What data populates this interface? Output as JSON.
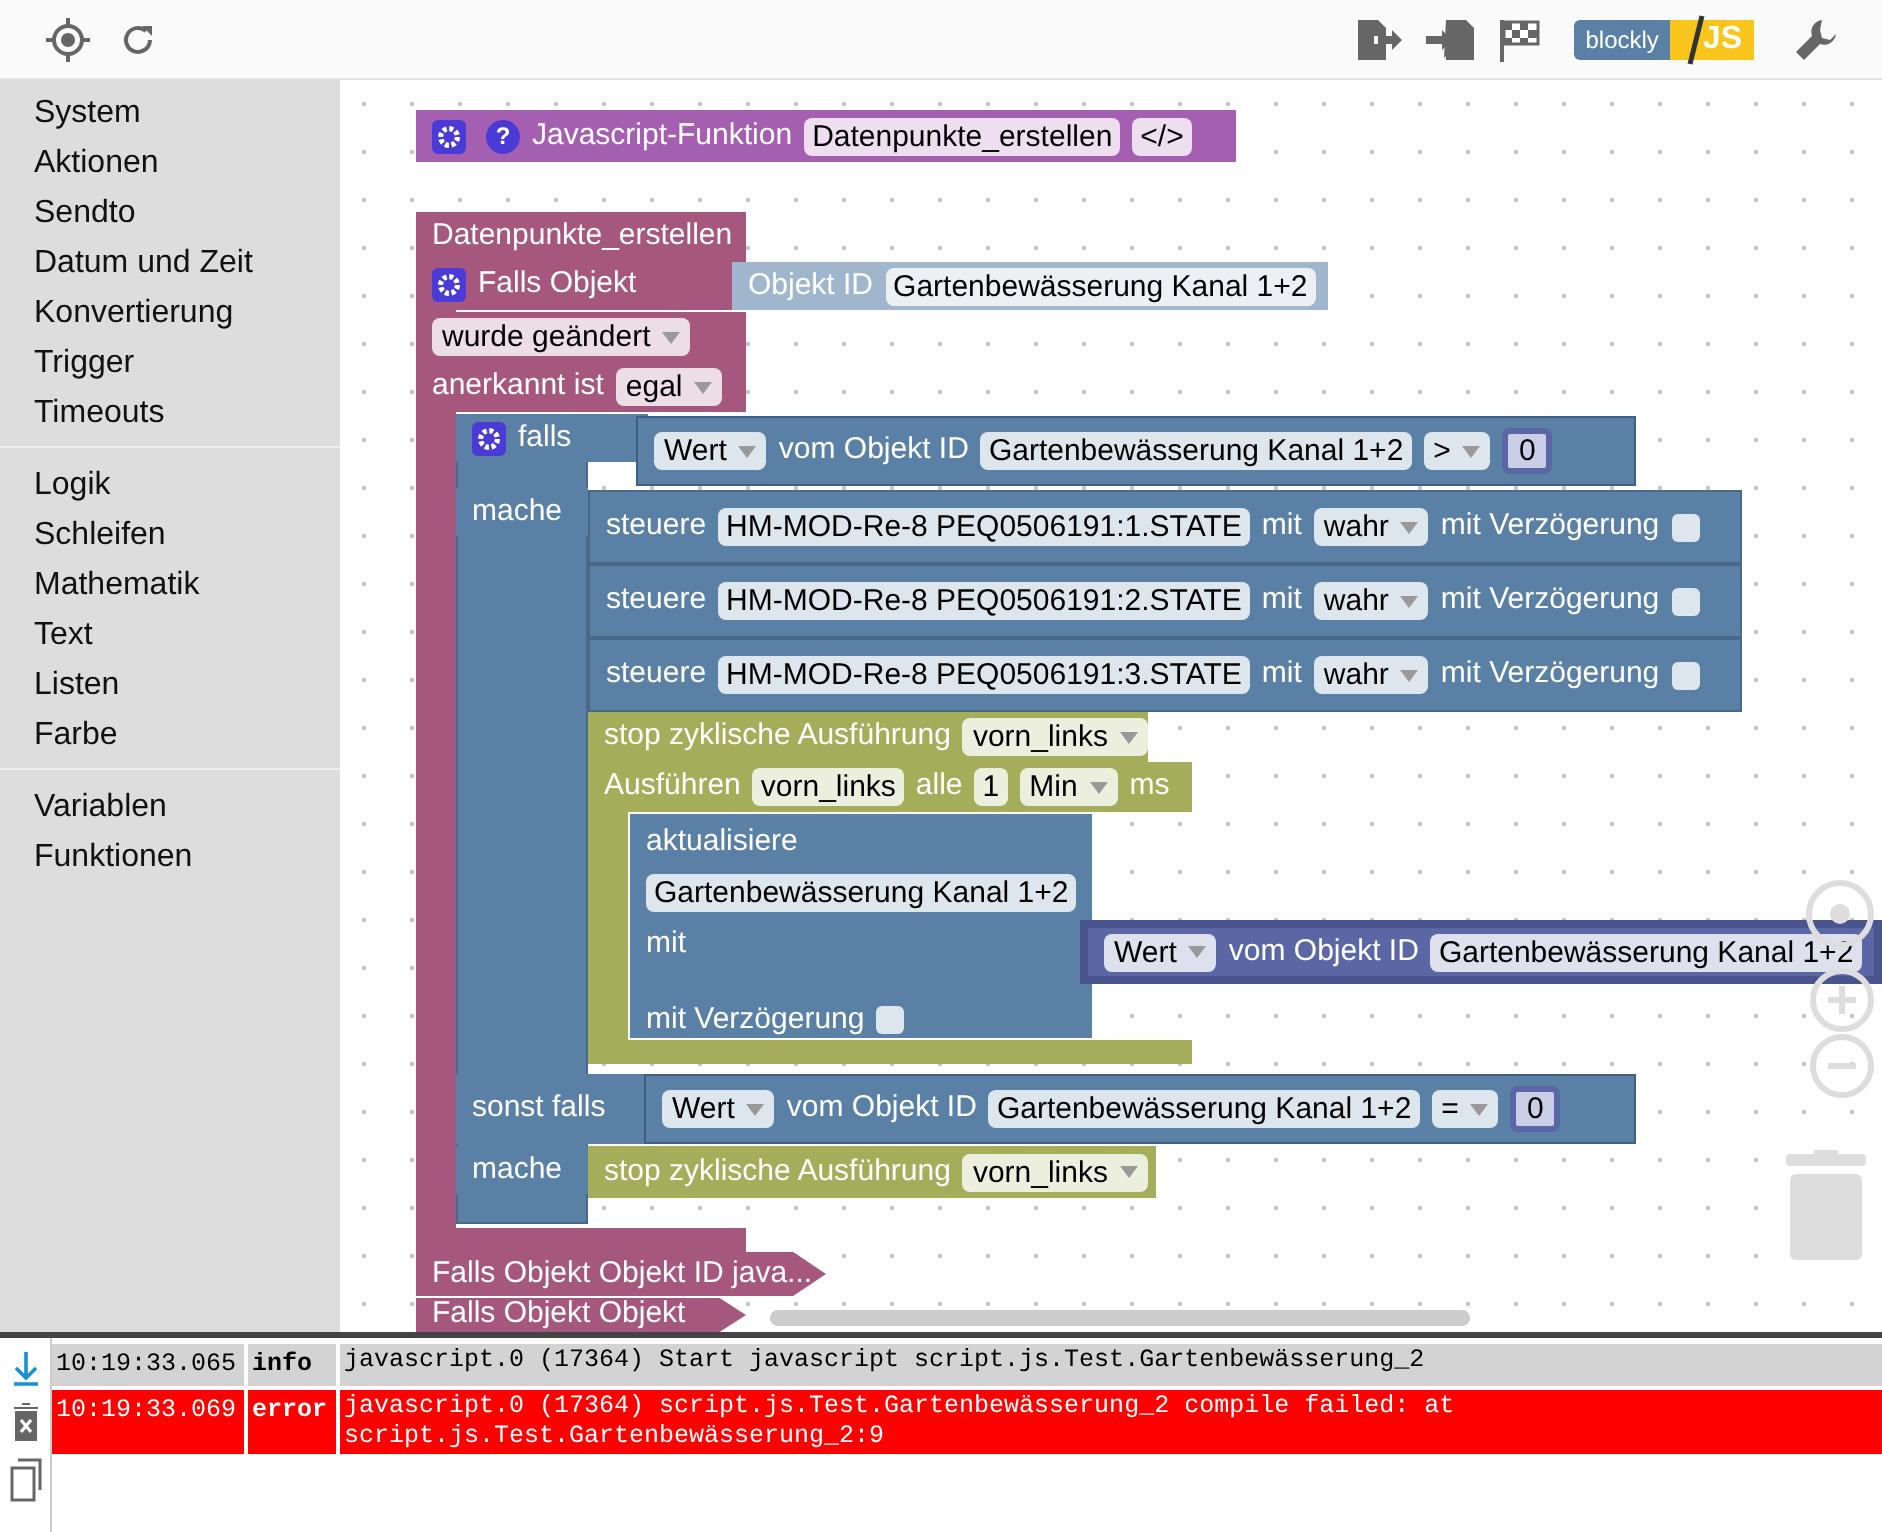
{
  "toolbar": {
    "mode_toggle": {
      "left": "blockly",
      "right": "JS"
    }
  },
  "sidebar": {
    "groups": [
      [
        "System",
        "Aktionen",
        "Sendto",
        "Datum und Zeit",
        "Konvertierung",
        "Trigger",
        "Timeouts"
      ],
      [
        "Logik",
        "Schleifen",
        "Mathematik",
        "Text",
        "Listen",
        "Farbe"
      ],
      [
        "Variablen",
        "Funktionen"
      ]
    ]
  },
  "blocks": [
    {
      "kind": "function",
      "parts": [
        {
          "kind": "gear"
        },
        {
          "kind": "help",
          "text": "?"
        },
        {
          "kind": "label",
          "text": "Javascript-Funktion"
        },
        {
          "kind": "field",
          "text": "Datenpunkte_erstellen"
        },
        {
          "kind": "field",
          "text": "</>"
        }
      ]
    },
    {
      "kind": "trigger",
      "parts": [
        {
          "kind": "label",
          "text": "Datenpunkte_erstellen"
        }
      ]
    },
    {
      "kind": "trigger",
      "parts": [
        {
          "kind": "gear"
        },
        {
          "kind": "label",
          "text": "Falls Objekt"
        }
      ]
    },
    {
      "kind": "objectid",
      "parts": [
        {
          "kind": "label",
          "text": "Objekt ID"
        },
        {
          "kind": "field",
          "text": "Gartenbewässerung Kanal 1+2"
        }
      ]
    },
    {
      "kind": "trigger",
      "parts": [
        {
          "kind": "dropdown",
          "text": "wurde geändert"
        }
      ]
    },
    {
      "kind": "trigger",
      "parts": [
        {
          "kind": "label",
          "text": "anerkannt ist"
        },
        {
          "kind": "dropdown",
          "text": "egal"
        }
      ]
    },
    {
      "kind": "logic",
      "parts": [
        {
          "kind": "gear"
        },
        {
          "kind": "label",
          "text": "falls"
        }
      ]
    },
    {
      "kind": "value",
      "parts": [
        {
          "kind": "dropdown",
          "text": "Wert"
        },
        {
          "kind": "label",
          "text": "vom Objekt ID"
        },
        {
          "kind": "field",
          "text": "Gartenbewässerung Kanal 1+2"
        },
        {
          "kind": "dropdown",
          "text": ">"
        },
        {
          "kind": "number",
          "text": "0"
        }
      ]
    },
    {
      "kind": "logic_label",
      "parts": [
        {
          "kind": "label",
          "text": "mache"
        }
      ]
    },
    {
      "kind": "action",
      "parts": [
        {
          "kind": "label",
          "text": "steuere"
        },
        {
          "kind": "field",
          "text": "HM-MOD-Re-8 PEQ0506191:1.STATE"
        },
        {
          "kind": "label",
          "text": "mit"
        },
        {
          "kind": "dropdown",
          "text": "wahr"
        },
        {
          "kind": "label",
          "text": "mit Verzögerung"
        },
        {
          "kind": "checkbox",
          "checked": false
        }
      ]
    },
    {
      "kind": "action",
      "parts": [
        {
          "kind": "label",
          "text": "steuere"
        },
        {
          "kind": "field",
          "text": "HM-MOD-Re-8 PEQ0506191:2.STATE"
        },
        {
          "kind": "label",
          "text": "mit"
        },
        {
          "kind": "dropdown",
          "text": "wahr"
        },
        {
          "kind": "label",
          "text": "mit Verzögerung"
        },
        {
          "kind": "checkbox",
          "checked": false
        }
      ]
    },
    {
      "kind": "action",
      "parts": [
        {
          "kind": "label",
          "text": "steuere"
        },
        {
          "kind": "field",
          "text": "HM-MOD-Re-8 PEQ0506191:3.STATE"
        },
        {
          "kind": "label",
          "text": "mit"
        },
        {
          "kind": "dropdown",
          "text": "wahr"
        },
        {
          "kind": "label",
          "text": "mit Verzögerung"
        },
        {
          "kind": "checkbox",
          "checked": false
        }
      ]
    },
    {
      "kind": "timeout",
      "parts": [
        {
          "kind": "label",
          "text": "stop zyklische Ausführung"
        },
        {
          "kind": "dropdown",
          "text": "vorn_links"
        }
      ]
    },
    {
      "kind": "timeout",
      "parts": [
        {
          "kind": "label",
          "text": "Ausführen"
        },
        {
          "kind": "field",
          "text": "vorn_links"
        },
        {
          "kind": "label",
          "text": "alle"
        },
        {
          "kind": "field",
          "text": "1"
        },
        {
          "kind": "dropdown",
          "text": "Min"
        },
        {
          "kind": "label",
          "text": "ms"
        }
      ]
    },
    {
      "kind": "action_column",
      "parts": [
        {
          "kind": "label",
          "text": "aktualisiere"
        },
        {
          "kind": "field",
          "text": "Gartenbewässerung Kanal 1+2"
        },
        {
          "kind": "label",
          "text": "mit"
        },
        {
          "kind": "label",
          "text": "mit Verzögerung"
        },
        {
          "kind": "checkbox",
          "checked": false
        }
      ]
    },
    {
      "kind": "value_dark",
      "parts": [
        {
          "kind": "dropdown",
          "text": "Wert"
        },
        {
          "kind": "label",
          "text": "vom Objekt ID"
        },
        {
          "kind": "field",
          "text": "Gartenbewässerung Kanal 1+2"
        }
      ]
    },
    {
      "kind": "logic_label",
      "parts": [
        {
          "kind": "label",
          "text": "sonst falls"
        }
      ]
    },
    {
      "kind": "value",
      "parts": [
        {
          "kind": "dropdown",
          "text": "Wert"
        },
        {
          "kind": "label",
          "text": "vom Objekt ID"
        },
        {
          "kind": "field",
          "text": "Gartenbewässerung Kanal 1+2"
        },
        {
          "kind": "dropdown",
          "text": "="
        },
        {
          "kind": "number",
          "text": "0"
        }
      ]
    },
    {
      "kind": "logic_label",
      "parts": [
        {
          "kind": "label",
          "text": "mache"
        }
      ]
    },
    {
      "kind": "timeout",
      "parts": [
        {
          "kind": "label",
          "text": "stop zyklische Ausführung"
        },
        {
          "kind": "dropdown",
          "text": "vorn_links"
        }
      ]
    },
    {
      "kind": "trigger_collapsed",
      "parts": [
        {
          "kind": "label",
          "text": "Falls Objekt Objekt ID java..."
        }
      ]
    },
    {
      "kind": "trigger_collapsed",
      "parts": [
        {
          "kind": "label",
          "text": "Falls Objekt Objekt"
        }
      ]
    }
  ],
  "log": [
    {
      "time": "10:19:33.065",
      "level": "info",
      "message": "javascript.0 (17364) Start javascript script.js.Test.Gartenbewässerung_2"
    },
    {
      "time": "10:19:33.069",
      "level": "error",
      "message": "javascript.0 (17364) script.js.Test.Gartenbewässerung_2 compile failed: at script.js.Test.Gartenbewässerung_2:9"
    }
  ]
}
